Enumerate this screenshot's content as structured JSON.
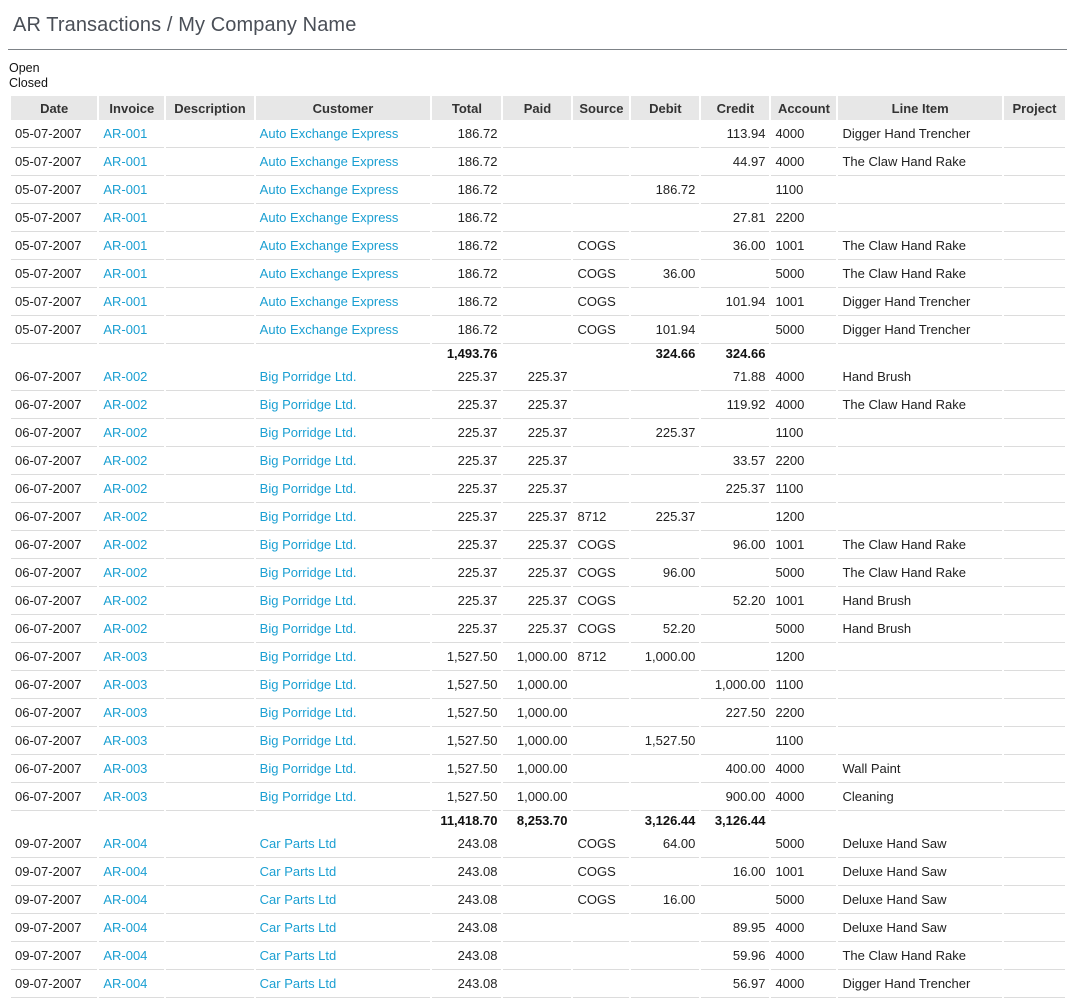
{
  "page": {
    "title": "AR Transactions / My Company Name",
    "filters": [
      "Open",
      "Closed"
    ]
  },
  "colors": {
    "link": "#1a9fd2",
    "header_bg": "#e7e7e7",
    "title": "#4a4f57"
  },
  "table": {
    "columns": [
      "Date",
      "Invoice",
      "Description",
      "Customer",
      "Total",
      "Paid",
      "Source",
      "Debit",
      "Credit",
      "Account",
      "Line Item",
      "Project"
    ],
    "rows": [
      {
        "date": "05-07-2007",
        "invoice": "AR-001",
        "description": "",
        "customer": "Auto Exchange Express",
        "total": "186.72",
        "paid": "",
        "source": "",
        "debit": "",
        "credit": "113.94",
        "account": "4000",
        "line_item": "Digger Hand Trencher",
        "project": ""
      },
      {
        "date": "05-07-2007",
        "invoice": "AR-001",
        "description": "",
        "customer": "Auto Exchange Express",
        "total": "186.72",
        "paid": "",
        "source": "",
        "debit": "",
        "credit": "44.97",
        "account": "4000",
        "line_item": "The Claw Hand Rake",
        "project": ""
      },
      {
        "date": "05-07-2007",
        "invoice": "AR-001",
        "description": "",
        "customer": "Auto Exchange Express",
        "total": "186.72",
        "paid": "",
        "source": "",
        "debit": "186.72",
        "credit": "",
        "account": "1100",
        "line_item": "",
        "project": ""
      },
      {
        "date": "05-07-2007",
        "invoice": "AR-001",
        "description": "",
        "customer": "Auto Exchange Express",
        "total": "186.72",
        "paid": "",
        "source": "",
        "debit": "",
        "credit": "27.81",
        "account": "2200",
        "line_item": "",
        "project": ""
      },
      {
        "date": "05-07-2007",
        "invoice": "AR-001",
        "description": "",
        "customer": "Auto Exchange Express",
        "total": "186.72",
        "paid": "",
        "source": "COGS",
        "debit": "",
        "credit": "36.00",
        "account": "1001",
        "line_item": "The Claw Hand Rake",
        "project": ""
      },
      {
        "date": "05-07-2007",
        "invoice": "AR-001",
        "description": "",
        "customer": "Auto Exchange Express",
        "total": "186.72",
        "paid": "",
        "source": "COGS",
        "debit": "36.00",
        "credit": "",
        "account": "5000",
        "line_item": "The Claw Hand Rake",
        "project": ""
      },
      {
        "date": "05-07-2007",
        "invoice": "AR-001",
        "description": "",
        "customer": "Auto Exchange Express",
        "total": "186.72",
        "paid": "",
        "source": "COGS",
        "debit": "",
        "credit": "101.94",
        "account": "1001",
        "line_item": "Digger Hand Trencher",
        "project": ""
      },
      {
        "date": "05-07-2007",
        "invoice": "AR-001",
        "description": "",
        "customer": "Auto Exchange Express",
        "total": "186.72",
        "paid": "",
        "source": "COGS",
        "debit": "101.94",
        "credit": "",
        "account": "5000",
        "line_item": "Digger Hand Trencher",
        "project": ""
      },
      {
        "subtotal": true,
        "total": "1,493.76",
        "paid": "",
        "debit": "324.66",
        "credit": "324.66"
      },
      {
        "date": "06-07-2007",
        "invoice": "AR-002",
        "description": "",
        "customer": "Big Porridge Ltd.",
        "total": "225.37",
        "paid": "225.37",
        "source": "",
        "debit": "",
        "credit": "71.88",
        "account": "4000",
        "line_item": "Hand Brush",
        "project": ""
      },
      {
        "date": "06-07-2007",
        "invoice": "AR-002",
        "description": "",
        "customer": "Big Porridge Ltd.",
        "total": "225.37",
        "paid": "225.37",
        "source": "",
        "debit": "",
        "credit": "119.92",
        "account": "4000",
        "line_item": "The Claw Hand Rake",
        "project": ""
      },
      {
        "date": "06-07-2007",
        "invoice": "AR-002",
        "description": "",
        "customer": "Big Porridge Ltd.",
        "total": "225.37",
        "paid": "225.37",
        "source": "",
        "debit": "225.37",
        "credit": "",
        "account": "1100",
        "line_item": "",
        "project": ""
      },
      {
        "date": "06-07-2007",
        "invoice": "AR-002",
        "description": "",
        "customer": "Big Porridge Ltd.",
        "total": "225.37",
        "paid": "225.37",
        "source": "",
        "debit": "",
        "credit": "33.57",
        "account": "2200",
        "line_item": "",
        "project": ""
      },
      {
        "date": "06-07-2007",
        "invoice": "AR-002",
        "description": "",
        "customer": "Big Porridge Ltd.",
        "total": "225.37",
        "paid": "225.37",
        "source": "",
        "debit": "",
        "credit": "225.37",
        "account": "1100",
        "line_item": "",
        "project": ""
      },
      {
        "date": "06-07-2007",
        "invoice": "AR-002",
        "description": "",
        "customer": "Big Porridge Ltd.",
        "total": "225.37",
        "paid": "225.37",
        "source": "8712",
        "debit": "225.37",
        "credit": "",
        "account": "1200",
        "line_item": "",
        "project": ""
      },
      {
        "date": "06-07-2007",
        "invoice": "AR-002",
        "description": "",
        "customer": "Big Porridge Ltd.",
        "total": "225.37",
        "paid": "225.37",
        "source": "COGS",
        "debit": "",
        "credit": "96.00",
        "account": "1001",
        "line_item": "The Claw Hand Rake",
        "project": ""
      },
      {
        "date": "06-07-2007",
        "invoice": "AR-002",
        "description": "",
        "customer": "Big Porridge Ltd.",
        "total": "225.37",
        "paid": "225.37",
        "source": "COGS",
        "debit": "96.00",
        "credit": "",
        "account": "5000",
        "line_item": "The Claw Hand Rake",
        "project": ""
      },
      {
        "date": "06-07-2007",
        "invoice": "AR-002",
        "description": "",
        "customer": "Big Porridge Ltd.",
        "total": "225.37",
        "paid": "225.37",
        "source": "COGS",
        "debit": "",
        "credit": "52.20",
        "account": "1001",
        "line_item": "Hand Brush",
        "project": ""
      },
      {
        "date": "06-07-2007",
        "invoice": "AR-002",
        "description": "",
        "customer": "Big Porridge Ltd.",
        "total": "225.37",
        "paid": "225.37",
        "source": "COGS",
        "debit": "52.20",
        "credit": "",
        "account": "5000",
        "line_item": "Hand Brush",
        "project": ""
      },
      {
        "date": "06-07-2007",
        "invoice": "AR-003",
        "description": "",
        "customer": "Big Porridge Ltd.",
        "total": "1,527.50",
        "paid": "1,000.00",
        "source": "8712",
        "debit": "1,000.00",
        "credit": "",
        "account": "1200",
        "line_item": "",
        "project": ""
      },
      {
        "date": "06-07-2007",
        "invoice": "AR-003",
        "description": "",
        "customer": "Big Porridge Ltd.",
        "total": "1,527.50",
        "paid": "1,000.00",
        "source": "",
        "debit": "",
        "credit": "1,000.00",
        "account": "1100",
        "line_item": "",
        "project": ""
      },
      {
        "date": "06-07-2007",
        "invoice": "AR-003",
        "description": "",
        "customer": "Big Porridge Ltd.",
        "total": "1,527.50",
        "paid": "1,000.00",
        "source": "",
        "debit": "",
        "credit": "227.50",
        "account": "2200",
        "line_item": "",
        "project": ""
      },
      {
        "date": "06-07-2007",
        "invoice": "AR-003",
        "description": "",
        "customer": "Big Porridge Ltd.",
        "total": "1,527.50",
        "paid": "1,000.00",
        "source": "",
        "debit": "1,527.50",
        "credit": "",
        "account": "1100",
        "line_item": "",
        "project": ""
      },
      {
        "date": "06-07-2007",
        "invoice": "AR-003",
        "description": "",
        "customer": "Big Porridge Ltd.",
        "total": "1,527.50",
        "paid": "1,000.00",
        "source": "",
        "debit": "",
        "credit": "400.00",
        "account": "4000",
        "line_item": "Wall Paint",
        "project": ""
      },
      {
        "date": "06-07-2007",
        "invoice": "AR-003",
        "description": "",
        "customer": "Big Porridge Ltd.",
        "total": "1,527.50",
        "paid": "1,000.00",
        "source": "",
        "debit": "",
        "credit": "900.00",
        "account": "4000",
        "line_item": "Cleaning",
        "project": ""
      },
      {
        "subtotal": true,
        "total": "11,418.70",
        "paid": "8,253.70",
        "debit": "3,126.44",
        "credit": "3,126.44"
      },
      {
        "date": "09-07-2007",
        "invoice": "AR-004",
        "description": "",
        "customer": "Car Parts Ltd",
        "total": "243.08",
        "paid": "",
        "source": "COGS",
        "debit": "64.00",
        "credit": "",
        "account": "5000",
        "line_item": "Deluxe Hand Saw",
        "project": ""
      },
      {
        "date": "09-07-2007",
        "invoice": "AR-004",
        "description": "",
        "customer": "Car Parts Ltd",
        "total": "243.08",
        "paid": "",
        "source": "COGS",
        "debit": "",
        "credit": "16.00",
        "account": "1001",
        "line_item": "Deluxe Hand Saw",
        "project": ""
      },
      {
        "date": "09-07-2007",
        "invoice": "AR-004",
        "description": "",
        "customer": "Car Parts Ltd",
        "total": "243.08",
        "paid": "",
        "source": "COGS",
        "debit": "16.00",
        "credit": "",
        "account": "5000",
        "line_item": "Deluxe Hand Saw",
        "project": ""
      },
      {
        "date": "09-07-2007",
        "invoice": "AR-004",
        "description": "",
        "customer": "Car Parts Ltd",
        "total": "243.08",
        "paid": "",
        "source": "",
        "debit": "",
        "credit": "89.95",
        "account": "4000",
        "line_item": "Deluxe Hand Saw",
        "project": ""
      },
      {
        "date": "09-07-2007",
        "invoice": "AR-004",
        "description": "",
        "customer": "Car Parts Ltd",
        "total": "243.08",
        "paid": "",
        "source": "",
        "debit": "",
        "credit": "59.96",
        "account": "4000",
        "line_item": "The Claw Hand Rake",
        "project": ""
      },
      {
        "date": "09-07-2007",
        "invoice": "AR-004",
        "description": "",
        "customer": "Car Parts Ltd",
        "total": "243.08",
        "paid": "",
        "source": "",
        "debit": "",
        "credit": "56.97",
        "account": "4000",
        "line_item": "Digger Hand Trencher",
        "project": ""
      }
    ]
  }
}
